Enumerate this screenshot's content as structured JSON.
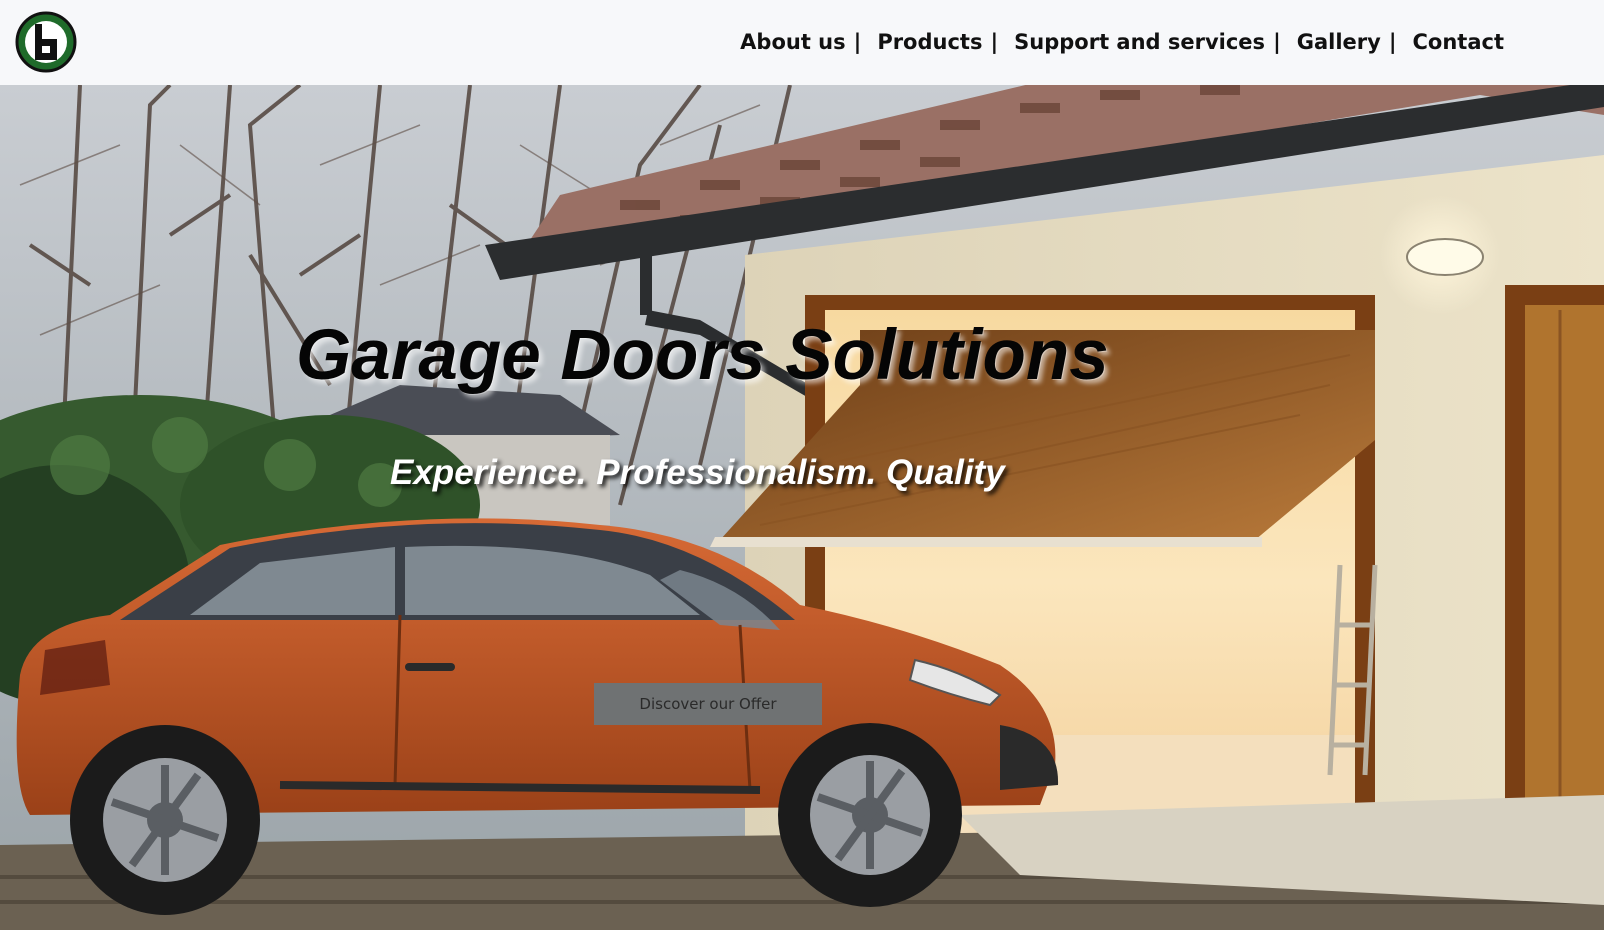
{
  "header": {
    "logo_icon": "g-circle-logo-icon",
    "nav": [
      {
        "label": "About us",
        "separator": "|"
      },
      {
        "label": "Products",
        "separator": "|"
      },
      {
        "label": "Support and services",
        "separator": "|"
      },
      {
        "label": "Gallery",
        "separator": "|"
      },
      {
        "label": "Contact",
        "separator": ""
      }
    ]
  },
  "hero": {
    "title": "Garage Doors Solutions",
    "subtitle": "Experience. Professionalism. Quality",
    "cta_label": "Discover our Offer",
    "background_image": "orange car parked in front of open garage with wooden up-and-over door"
  },
  "colors": {
    "header_bg": "#f7f8fa",
    "logo_green": "#1f6b2a",
    "cta_bg": "#6f7273",
    "car_orange": "#c0572a"
  }
}
